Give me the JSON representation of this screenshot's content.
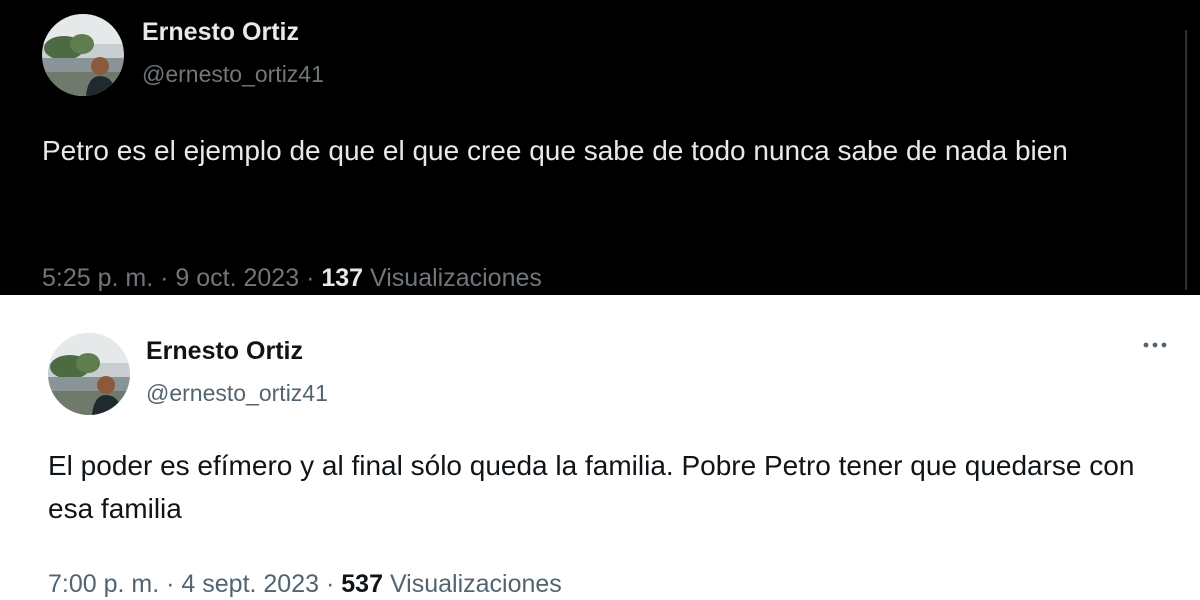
{
  "tweets": [
    {
      "theme": "dark",
      "author_name": "Ernesto Ortiz",
      "author_handle": "@ernesto_ortiz41",
      "text": "Petro es el ejemplo de que el que cree que sabe de todo nunca sabe de nada bien",
      "time": "5:25 p. m.",
      "date": "9 oct. 2023",
      "views_count": "137",
      "views_label": "Visualizaciones"
    },
    {
      "theme": "light",
      "author_name": "Ernesto Ortiz",
      "author_handle": "@ernesto_ortiz41",
      "text": "El poder es efímero y al final sólo queda la familia. Pobre Petro tener que quedarse con esa familia",
      "time": "7:00 p. m.",
      "date": "4 sept. 2023",
      "views_count": "537",
      "views_label": "Visualizaciones",
      "more_icon": "more-options-icon"
    }
  ],
  "separator": "·",
  "colors": {
    "dark_bg": "#000000",
    "dark_text": "#e7e9ea",
    "dark_muted": "#71767b",
    "light_bg": "#ffffff",
    "light_text": "#0f1419",
    "light_muted": "#536471"
  }
}
